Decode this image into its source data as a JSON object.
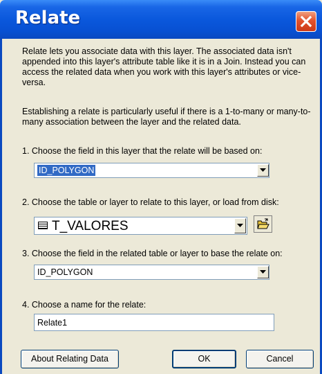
{
  "dialog": {
    "title": "Relate",
    "description_1": "Relate lets you associate data with this layer. The associated data isn't appended into this layer's attribute table like it is in a Join. Instead you can access the related data when you work with this layer's attributes or vice-versa.",
    "description_2": "Establishing a relate is particularly useful if there is a 1-to-many or many-to-many association between the layer and the related data."
  },
  "step1": {
    "label": "1. Choose the field in this layer that the relate will be based on:",
    "value": "ID_POLYGON"
  },
  "step2": {
    "label": "2. Choose the table or layer to relate to this layer, or load from disk:",
    "value": "T_VALORES",
    "icon": "table-icon"
  },
  "step3": {
    "label": "3. Choose the field in the related table or layer to base the relate on:",
    "value": "ID_POLYGON"
  },
  "step4": {
    "label": "4. Choose a name for the relate:",
    "value": "Relate1"
  },
  "buttons": {
    "about": "About Relating Data",
    "ok": "OK",
    "cancel": "Cancel"
  },
  "colors": {
    "titlebar": "#0a58dc",
    "selection": "#316ac5",
    "dialog_bg": "#ece9d8"
  }
}
